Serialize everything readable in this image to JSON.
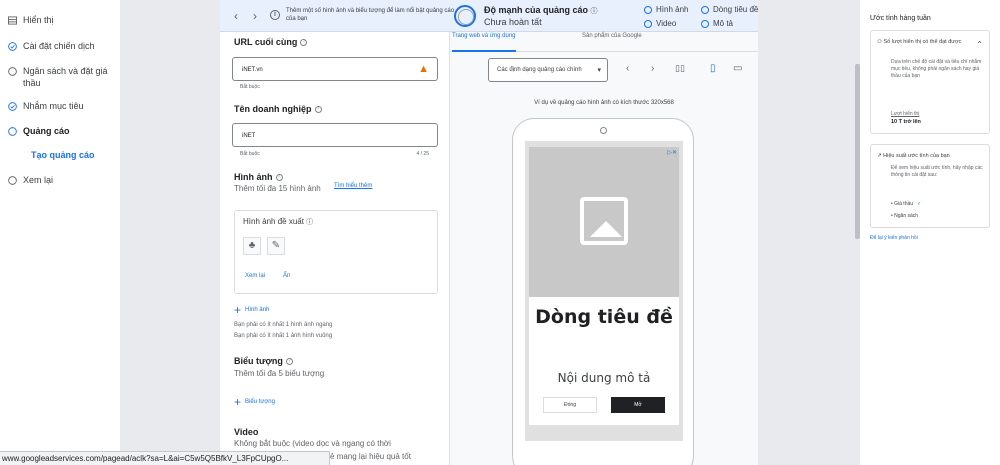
{
  "nav": {
    "items": [
      {
        "label": "Hiển thị",
        "icon": "grid-icon"
      },
      {
        "label": "Cài đặt chiến dịch",
        "icon": "check-circle-icon"
      },
      {
        "label": "Ngân sách và đặt giá thầu",
        "icon": "radio-empty-icon"
      },
      {
        "label": "Nhắm mục tiêu",
        "icon": "check-circle-icon"
      },
      {
        "label": "Quảng cáo",
        "icon": "radio-empty-icon"
      },
      {
        "label": "Xem lại",
        "icon": "radio-empty-icon"
      }
    ],
    "sub_item": "Tạo quảng cáo"
  },
  "topbar": {
    "note": "Thêm một số hình ảnh và biểu tượng để làm nổi bật quảng cáo của bạn",
    "strength_title": "Độ mạnh của quảng cáo",
    "strength_status": "Chưa hoàn tất",
    "checks": [
      "Hình ảnh",
      "Dòng tiêu đề",
      "Video",
      "Mô tả"
    ]
  },
  "form": {
    "final_url_label": "URL cuối cùng",
    "final_url_value": "iNET.vn",
    "required": "Bắt buộc",
    "business_name_label": "Tên doanh nghiệp",
    "business_name_value": "iNET",
    "business_name_count": "4 / 25",
    "images_label": "Hình ảnh",
    "images_hint": "Thêm tối đa 15 hình ảnh",
    "learn_more": "Tìm hiểu thêm",
    "suggest_title": "Hình ảnh đề xuất",
    "suggest_view": "Xem lại",
    "suggest_hide": "Ẩn",
    "add_image": "Hình ảnh",
    "image_req_1": "Bạn phải có ít nhất 1 hình ảnh ngang",
    "image_req_2": "Bạn phải có ít nhất 1 ảnh hình vuông",
    "logos_label": "Biểu tượng",
    "logos_hint": "Thêm tối đa 5 biểu tượng",
    "add_logo": "Biểu tượng",
    "video_label": "Video",
    "video_hint": "Không bắt buộc (video dọc và ngang có thời",
    "video_hint_2": "ẻ mang lại hiệu quả tốt"
  },
  "preview": {
    "tabs": [
      "Trang web và ứng dụng",
      "Sản phẩm của Google"
    ],
    "format_select": "Các định dạng quảng cáo chính",
    "caption": "Ví dụ về quảng cáo hình ảnh có kích thước 320x568",
    "ad_headline": "Dòng tiêu đề",
    "ad_description": "Nội dung mô tả",
    "ad_btn_close": "Đóng",
    "ad_btn_open": "Mở"
  },
  "estimate": {
    "title": "Ước tính hàng tuần",
    "card1_head": "Số lượt hiển thị có thể đạt được",
    "card1_body": "Dựa trên chế độ cài đặt và tiêu chí nhắm mục tiêu, không phải ngân sách hay giá thầu của bạn",
    "card1_sub": "Lượt hiển thị",
    "card1_value": "10 T trở lên",
    "card2_head": "Hiệu suất ước tính của bạn",
    "card2_body": "Để xem hiệu suất ước tính, hãy nhập các thông tin cài đặt sau:",
    "bullet_bid": "Giá thầu",
    "bullet_budget": "Ngân sách",
    "feedback": "Để lại ý kiến phản hồi"
  },
  "statusbar": {
    "url": "www.googleadservices.com/pagead/aclk?sa=L&ai=C5w5Q5BfkV_L3FpCUpgO..."
  },
  "colors": {
    "accent": "#1a73e8",
    "warning": "#e37400",
    "success": "#188038"
  }
}
